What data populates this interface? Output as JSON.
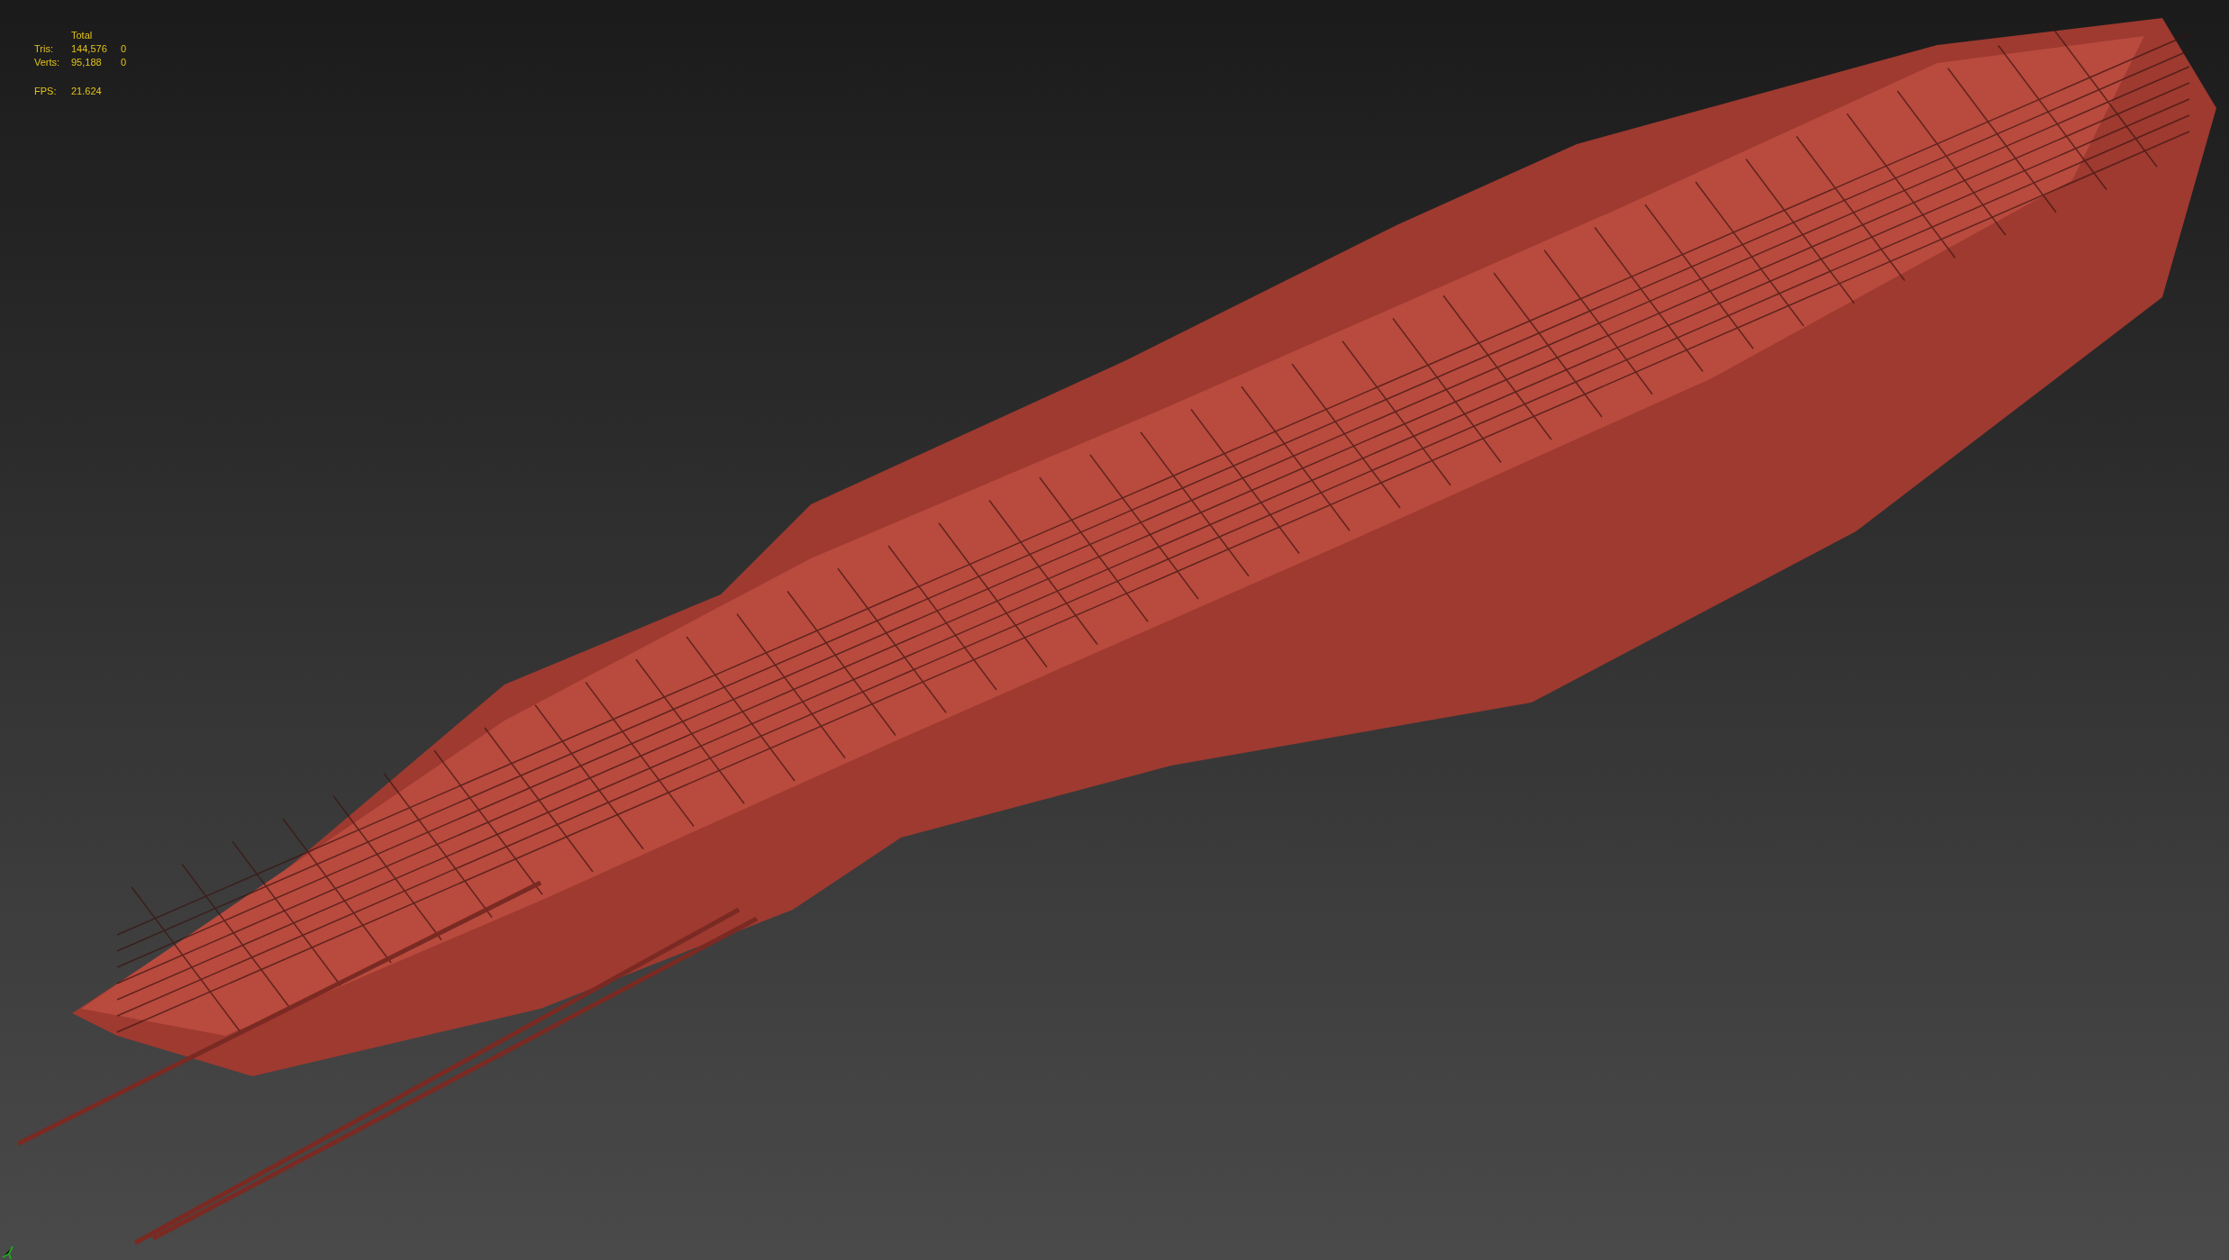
{
  "viewport": {
    "stats": {
      "header": "Total",
      "rows": [
        {
          "label": "Tris:",
          "total": "144,576",
          "selected": "0"
        },
        {
          "label": "Verts:",
          "total": "95,188",
          "selected": "0"
        }
      ],
      "fps": {
        "label": "FPS:",
        "value": "21.624"
      }
    }
  }
}
